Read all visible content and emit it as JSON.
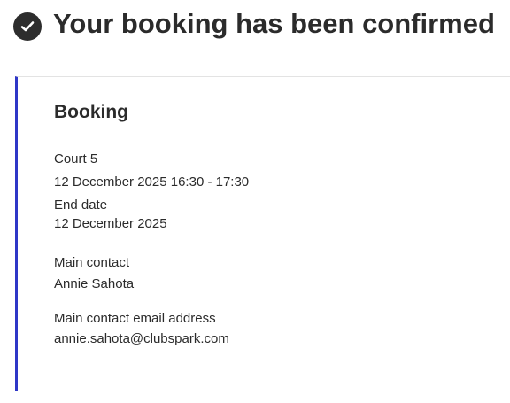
{
  "header": {
    "title": "Your booking has been confirmed",
    "icon": "check-circle-icon"
  },
  "booking": {
    "heading": "Booking",
    "court": "Court 5",
    "datetime": "12 December 2025 16:30 - 17:30",
    "end_date_label": "End date",
    "end_date_value": "12 December 2025",
    "main_contact_label": "Main contact",
    "main_contact_value": "Annie Sahota",
    "email_label": "Main contact email address",
    "email_value": "annie.sahota@clubspark.com"
  },
  "colors": {
    "accent_border": "#2f37c7",
    "text": "#2b2b2b"
  }
}
